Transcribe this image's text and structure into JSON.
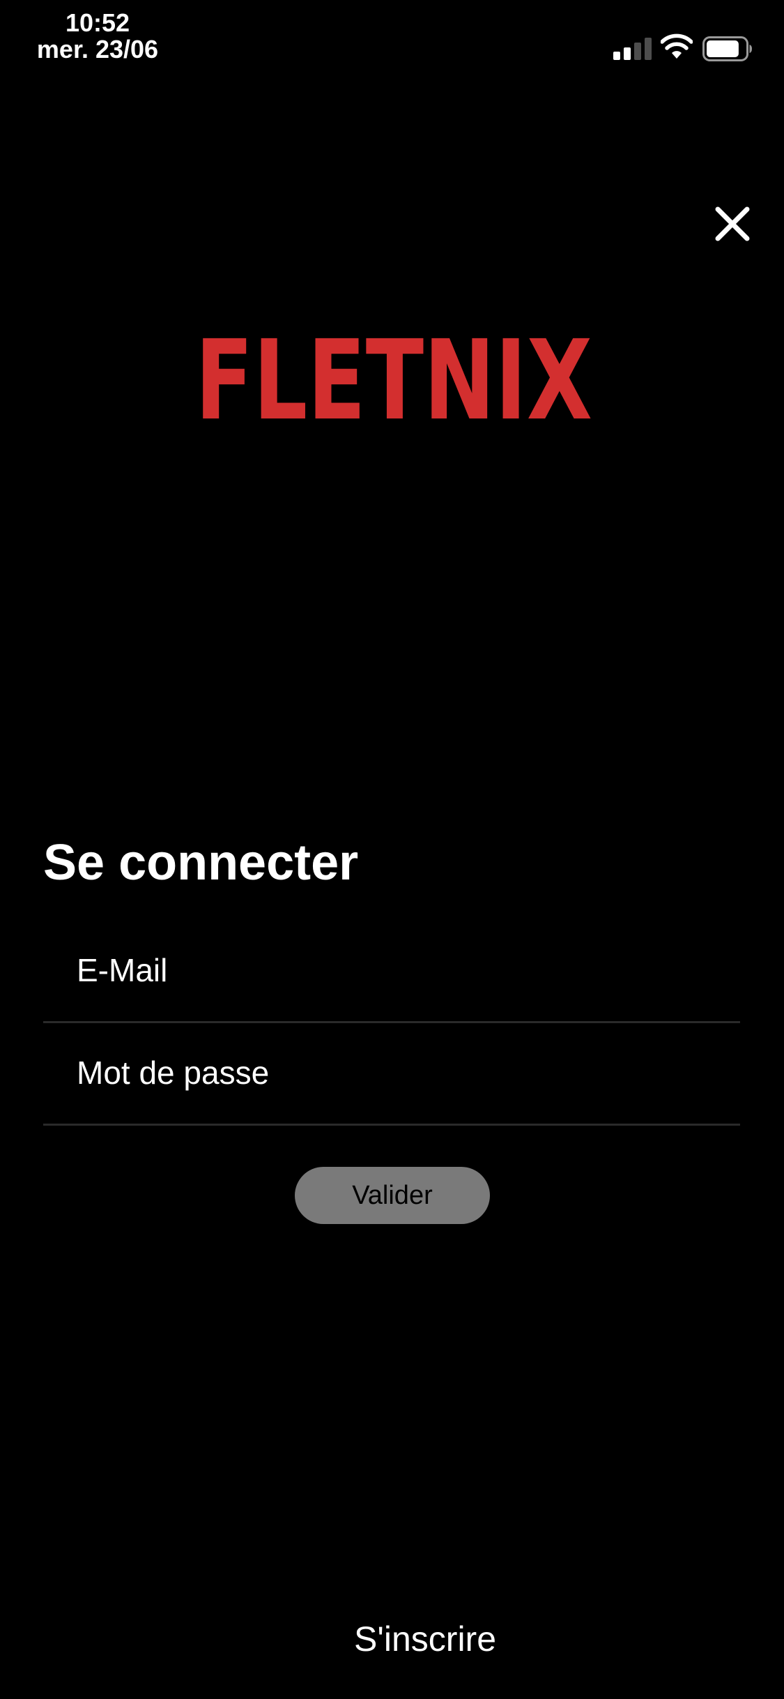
{
  "status_bar": {
    "time": "10:52",
    "date": "mer. 23/06",
    "signal_bars_active": 2,
    "signal_bars_total": 4,
    "battery_level": 0.85,
    "icons": [
      "signal-icon",
      "wifi-icon",
      "battery-icon"
    ]
  },
  "header": {
    "close_icon": "close-icon"
  },
  "logo": {
    "text": "FLETNIX",
    "color": "#d32f2f"
  },
  "login": {
    "title": "Se connecter",
    "email_placeholder": "E-Mail",
    "password_placeholder": "Mot de passe",
    "submit_label": "Valider"
  },
  "footer": {
    "signup_label": "S'inscrire"
  },
  "colors": {
    "background": "#000000",
    "text": "#ffffff",
    "button": "#7a7a7a",
    "divider": "#2a2a2a",
    "brand": "#d32f2f"
  }
}
